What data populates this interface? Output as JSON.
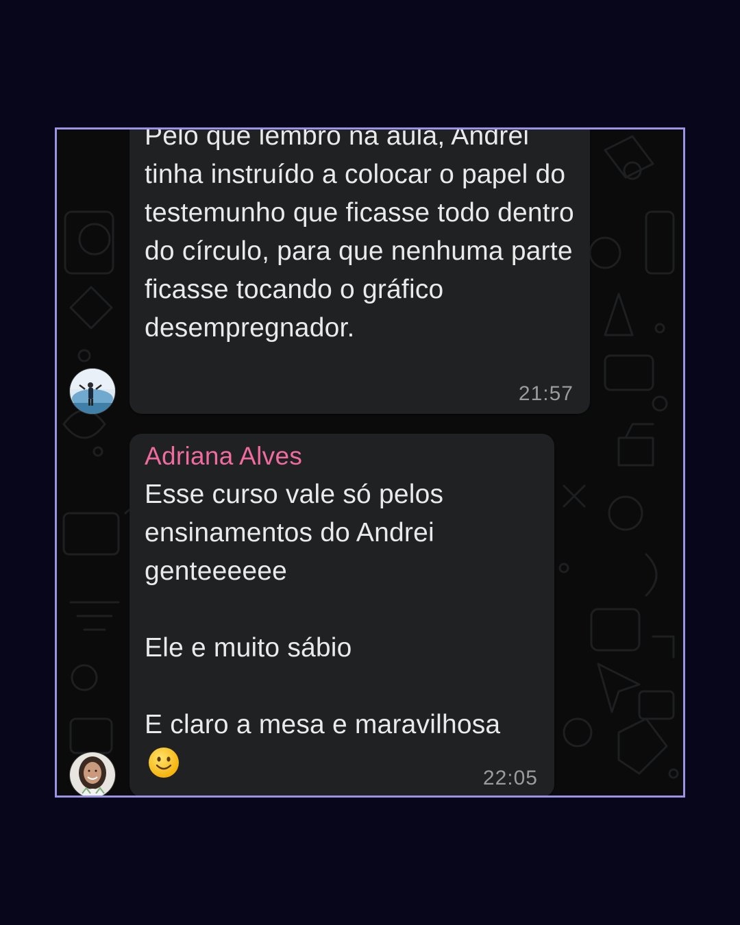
{
  "chat": {
    "messages": [
      {
        "text": "Pelo que lembro na aula, Andrei tinha instruído a colocar o papel do testemunho que ficasse todo dentro do círculo, para que nenhuma parte ficasse tocando o gráfico desempregnador.",
        "time": "21:57",
        "avatar_icon": "user-avatar-photo-beach"
      },
      {
        "sender": "Adriana Alves",
        "text": "Esse curso vale só pelos ensinamentos do Andrei genteeeeee\n\nEle e muito sábio\n\nE claro a mesa e maravilhosa",
        "emoji_icon": "slightly-smiling-face-icon",
        "time": "22:05",
        "avatar_icon": "user-avatar-photo-woman"
      }
    ]
  },
  "colors": {
    "page_background": "#07061a",
    "frame_border": "#9b93e6",
    "chat_background": "#0b0b0c",
    "bubble": "#1f2123",
    "message_text": "#eaeaea",
    "sender_name": "#f06b9f",
    "timestamp": "#9a9c9e"
  }
}
